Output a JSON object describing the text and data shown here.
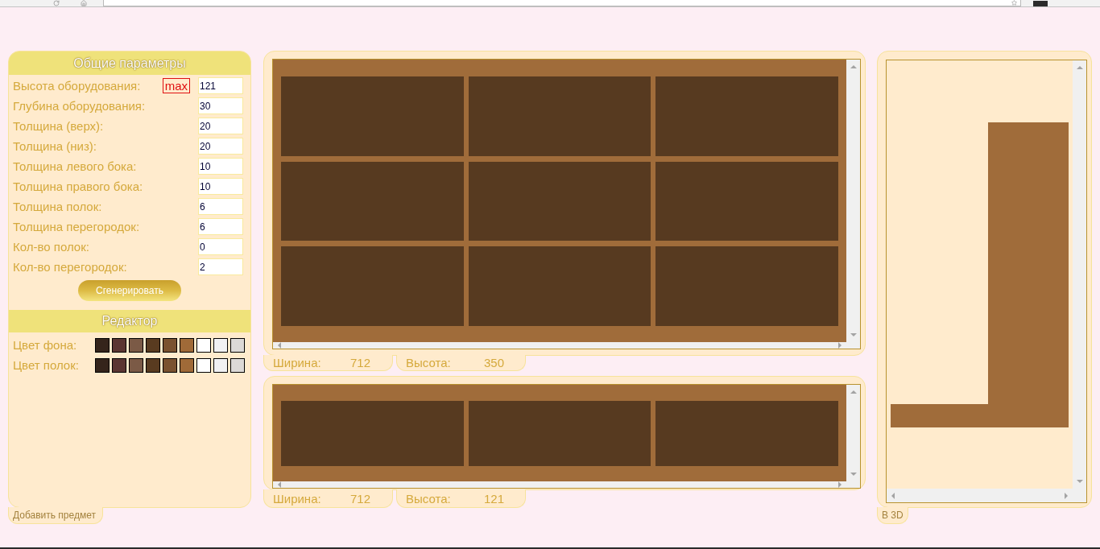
{
  "params_panel": {
    "title": "Общие параметры",
    "fields": [
      {
        "label": "Высота оборудования:",
        "value": "121",
        "badge": "max"
      },
      {
        "label": "Глубина оборудования:",
        "value": "30"
      },
      {
        "label": "Толщина (верх):",
        "value": "20"
      },
      {
        "label": "Толщина (низ):",
        "value": "20"
      },
      {
        "label": "Толщина левого бока:",
        "value": "10"
      },
      {
        "label": "Толщина правого бока:",
        "value": "10"
      },
      {
        "label": "Толщина полок:",
        "value": "6"
      },
      {
        "label": "Толщина перегородок:",
        "value": "6"
      },
      {
        "label": "Кол-во полок:",
        "value": "0"
      },
      {
        "label": "Кол-во перегородок:",
        "value": "2"
      }
    ],
    "generate_button": "Сгенерировать"
  },
  "editor_panel": {
    "title": "Редактор",
    "palettes": [
      {
        "label": "Цвет фона:",
        "swatches": [
          {
            "color": "#35241b"
          },
          {
            "color": "#5b3532"
          },
          {
            "color": "#7b5a46"
          },
          {
            "color": "#593b20"
          },
          {
            "color": "#7a5230"
          },
          {
            "color": "#a06a38"
          },
          {
            "color": "#ffffff"
          },
          {
            "color": "#f1f1f3"
          },
          {
            "color": "#dcd9d7"
          }
        ]
      },
      {
        "label": "Цвет полок:",
        "swatches": [
          {
            "color": "#35241b"
          },
          {
            "color": "#5b3532"
          },
          {
            "color": "#7b5a46"
          },
          {
            "color": "#593b20"
          },
          {
            "color": "#7a5230"
          },
          {
            "color": "#a06a38"
          },
          {
            "color": "#ffffff"
          },
          {
            "color": "#f1f1f3"
          },
          {
            "color": "#dcd9d7"
          }
        ]
      }
    ]
  },
  "add_item_tab": "Добавить предмет",
  "views": [
    {
      "kind": "front",
      "width_label": "Ширина:",
      "width_value": "712",
      "height_label": "Высота:",
      "height_value": "350"
    },
    {
      "kind": "top",
      "width_label": "Ширина:",
      "width_value": "712",
      "height_label": "Высота:",
      "height_value": "121"
    }
  ],
  "side_view": {
    "tab": "В 3D"
  }
}
